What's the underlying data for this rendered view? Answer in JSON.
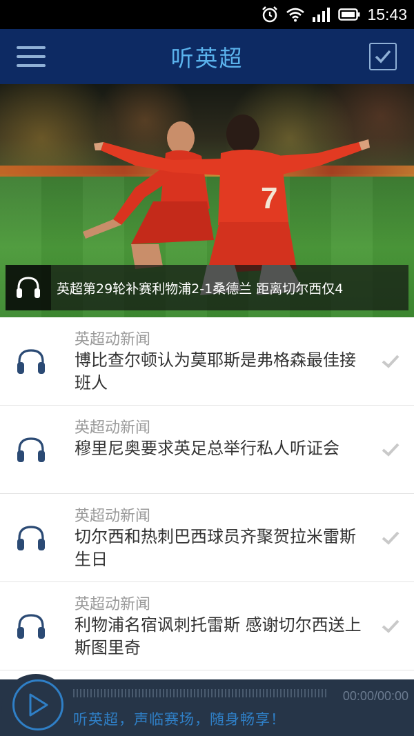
{
  "status_bar": {
    "time": "15:43"
  },
  "header": {
    "title": "听英超"
  },
  "banner": {
    "caption": "英超第29轮补赛利物浦2-1桑德兰 距离切尔西仅4"
  },
  "news": [
    {
      "category": "英超动新闻",
      "title": "博比查尔顿认为莫耶斯是弗格森最佳接班人"
    },
    {
      "category": "英超动新闻",
      "title": "穆里尼奥要求英足总举行私人听证会"
    },
    {
      "category": "英超动新闻",
      "title": "切尔西和热刺巴西球员齐聚贺拉米雷斯生日"
    },
    {
      "category": "英超动新闻",
      "title": "利物浦名宿讽刺托雷斯 感谢切尔西送上斯图里奇"
    }
  ],
  "player": {
    "time": "00:00/00:00",
    "slogan": "听英超，声临赛场，随身畅享！"
  },
  "colors": {
    "header_bg": "#0d2a63",
    "title": "#5ab2ec",
    "player_bg": "#263548",
    "accent": "#2f7fc6"
  }
}
